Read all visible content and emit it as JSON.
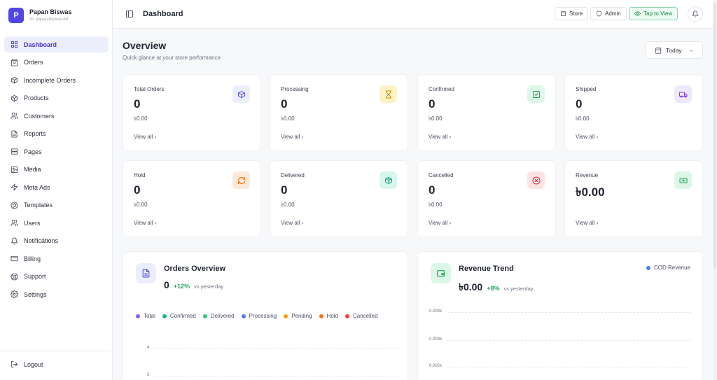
{
  "user": {
    "initial": "P",
    "name": "Papan Biswas",
    "id_text": "ID: papan-biswas-bd"
  },
  "nav": [
    {
      "label": "Dashboard",
      "icon": "dashboard-icon"
    },
    {
      "label": "Orders",
      "icon": "orders-icon"
    },
    {
      "label": "Incomplete Orders",
      "icon": "incomplete-orders-icon"
    },
    {
      "label": "Products",
      "icon": "products-icon"
    },
    {
      "label": "Customers",
      "icon": "customers-icon"
    },
    {
      "label": "Reports",
      "icon": "reports-icon"
    },
    {
      "label": "Pages",
      "icon": "pages-icon"
    },
    {
      "label": "Media",
      "icon": "media-icon"
    },
    {
      "label": "Meta Ads",
      "icon": "meta-ads-icon"
    },
    {
      "label": "Templates",
      "icon": "templates-icon"
    },
    {
      "label": "Users",
      "icon": "users-icon"
    },
    {
      "label": "Notifications",
      "icon": "notifications-icon"
    },
    {
      "label": "Billing",
      "icon": "billing-icon"
    },
    {
      "label": "Support",
      "icon": "support-icon"
    },
    {
      "label": "Settings",
      "icon": "settings-icon"
    }
  ],
  "logout_label": "Logout",
  "topbar": {
    "title": "Dashboard",
    "store": "Store",
    "admin": "Admin",
    "tap_to_view": "Tap to View"
  },
  "overview": {
    "title": "Overview",
    "subtitle": "Quick glance at your store performance",
    "range": "Today"
  },
  "stats": [
    {
      "label": "Total Orders",
      "value": "0",
      "sub": "৳0.00",
      "link": "View all",
      "icon": "cube-icon",
      "bg": "#eceefc",
      "fg": "#4f46e5"
    },
    {
      "label": "Processing",
      "value": "0",
      "sub": "৳0.00",
      "link": "View all",
      "icon": "hourglass-icon",
      "bg": "#fdf3c7",
      "fg": "#c58a00"
    },
    {
      "label": "Confirmed",
      "value": "0",
      "sub": "৳0.00",
      "link": "View all",
      "icon": "check-square-icon",
      "bg": "#dcf7e7",
      "fg": "#16a34a"
    },
    {
      "label": "Shipped",
      "value": "0",
      "sub": "৳0.00",
      "link": "View all",
      "icon": "truck-icon",
      "bg": "#efe8fd",
      "fg": "#7c3aed"
    },
    {
      "label": "Hold",
      "value": "0",
      "sub": "৳0.00",
      "link": "View all",
      "icon": "refresh-icon",
      "bg": "#fde9d9",
      "fg": "#ea6c0a"
    },
    {
      "label": "Delivered",
      "value": "0",
      "sub": "৳0.00",
      "link": "View all",
      "icon": "package-icon",
      "bg": "#d9f6ea",
      "fg": "#0f9f6e"
    },
    {
      "label": "Cancelled",
      "value": "0",
      "sub": "৳0.00",
      "link": "View all",
      "icon": "x-circle-icon",
      "bg": "#fde3e3",
      "fg": "#dc2626"
    },
    {
      "label": "Revenue",
      "value": "৳0.00",
      "sub": "",
      "link": "View all",
      "icon": "banknote-icon",
      "bg": "#dcf7e7",
      "fg": "#16a34a"
    }
  ],
  "orders_overview": {
    "title": "Orders Overview",
    "value": "0",
    "change": "+12%",
    "vs": "vs yesterday",
    "legend": [
      {
        "label": "Total",
        "color": "#8b5cf6"
      },
      {
        "label": "Confirmed",
        "color": "#10b981"
      },
      {
        "label": "Delivered",
        "color": "#34c77b"
      },
      {
        "label": "Processing",
        "color": "#4f7ef0"
      },
      {
        "label": "Pending",
        "color": "#f59e0b"
      },
      {
        "label": "Hold",
        "color": "#f97316"
      },
      {
        "label": "Cancelled",
        "color": "#ef4444"
      }
    ],
    "y_ticks": [
      "4",
      "3"
    ]
  },
  "revenue_trend": {
    "title": "Revenue Trend",
    "value": "৳0.00",
    "change": "+8%",
    "vs": "vs yesterday",
    "legend_label": "COD Revenue",
    "y_ticks": [
      "0.004k",
      "0.003k",
      "0.002k"
    ]
  }
}
